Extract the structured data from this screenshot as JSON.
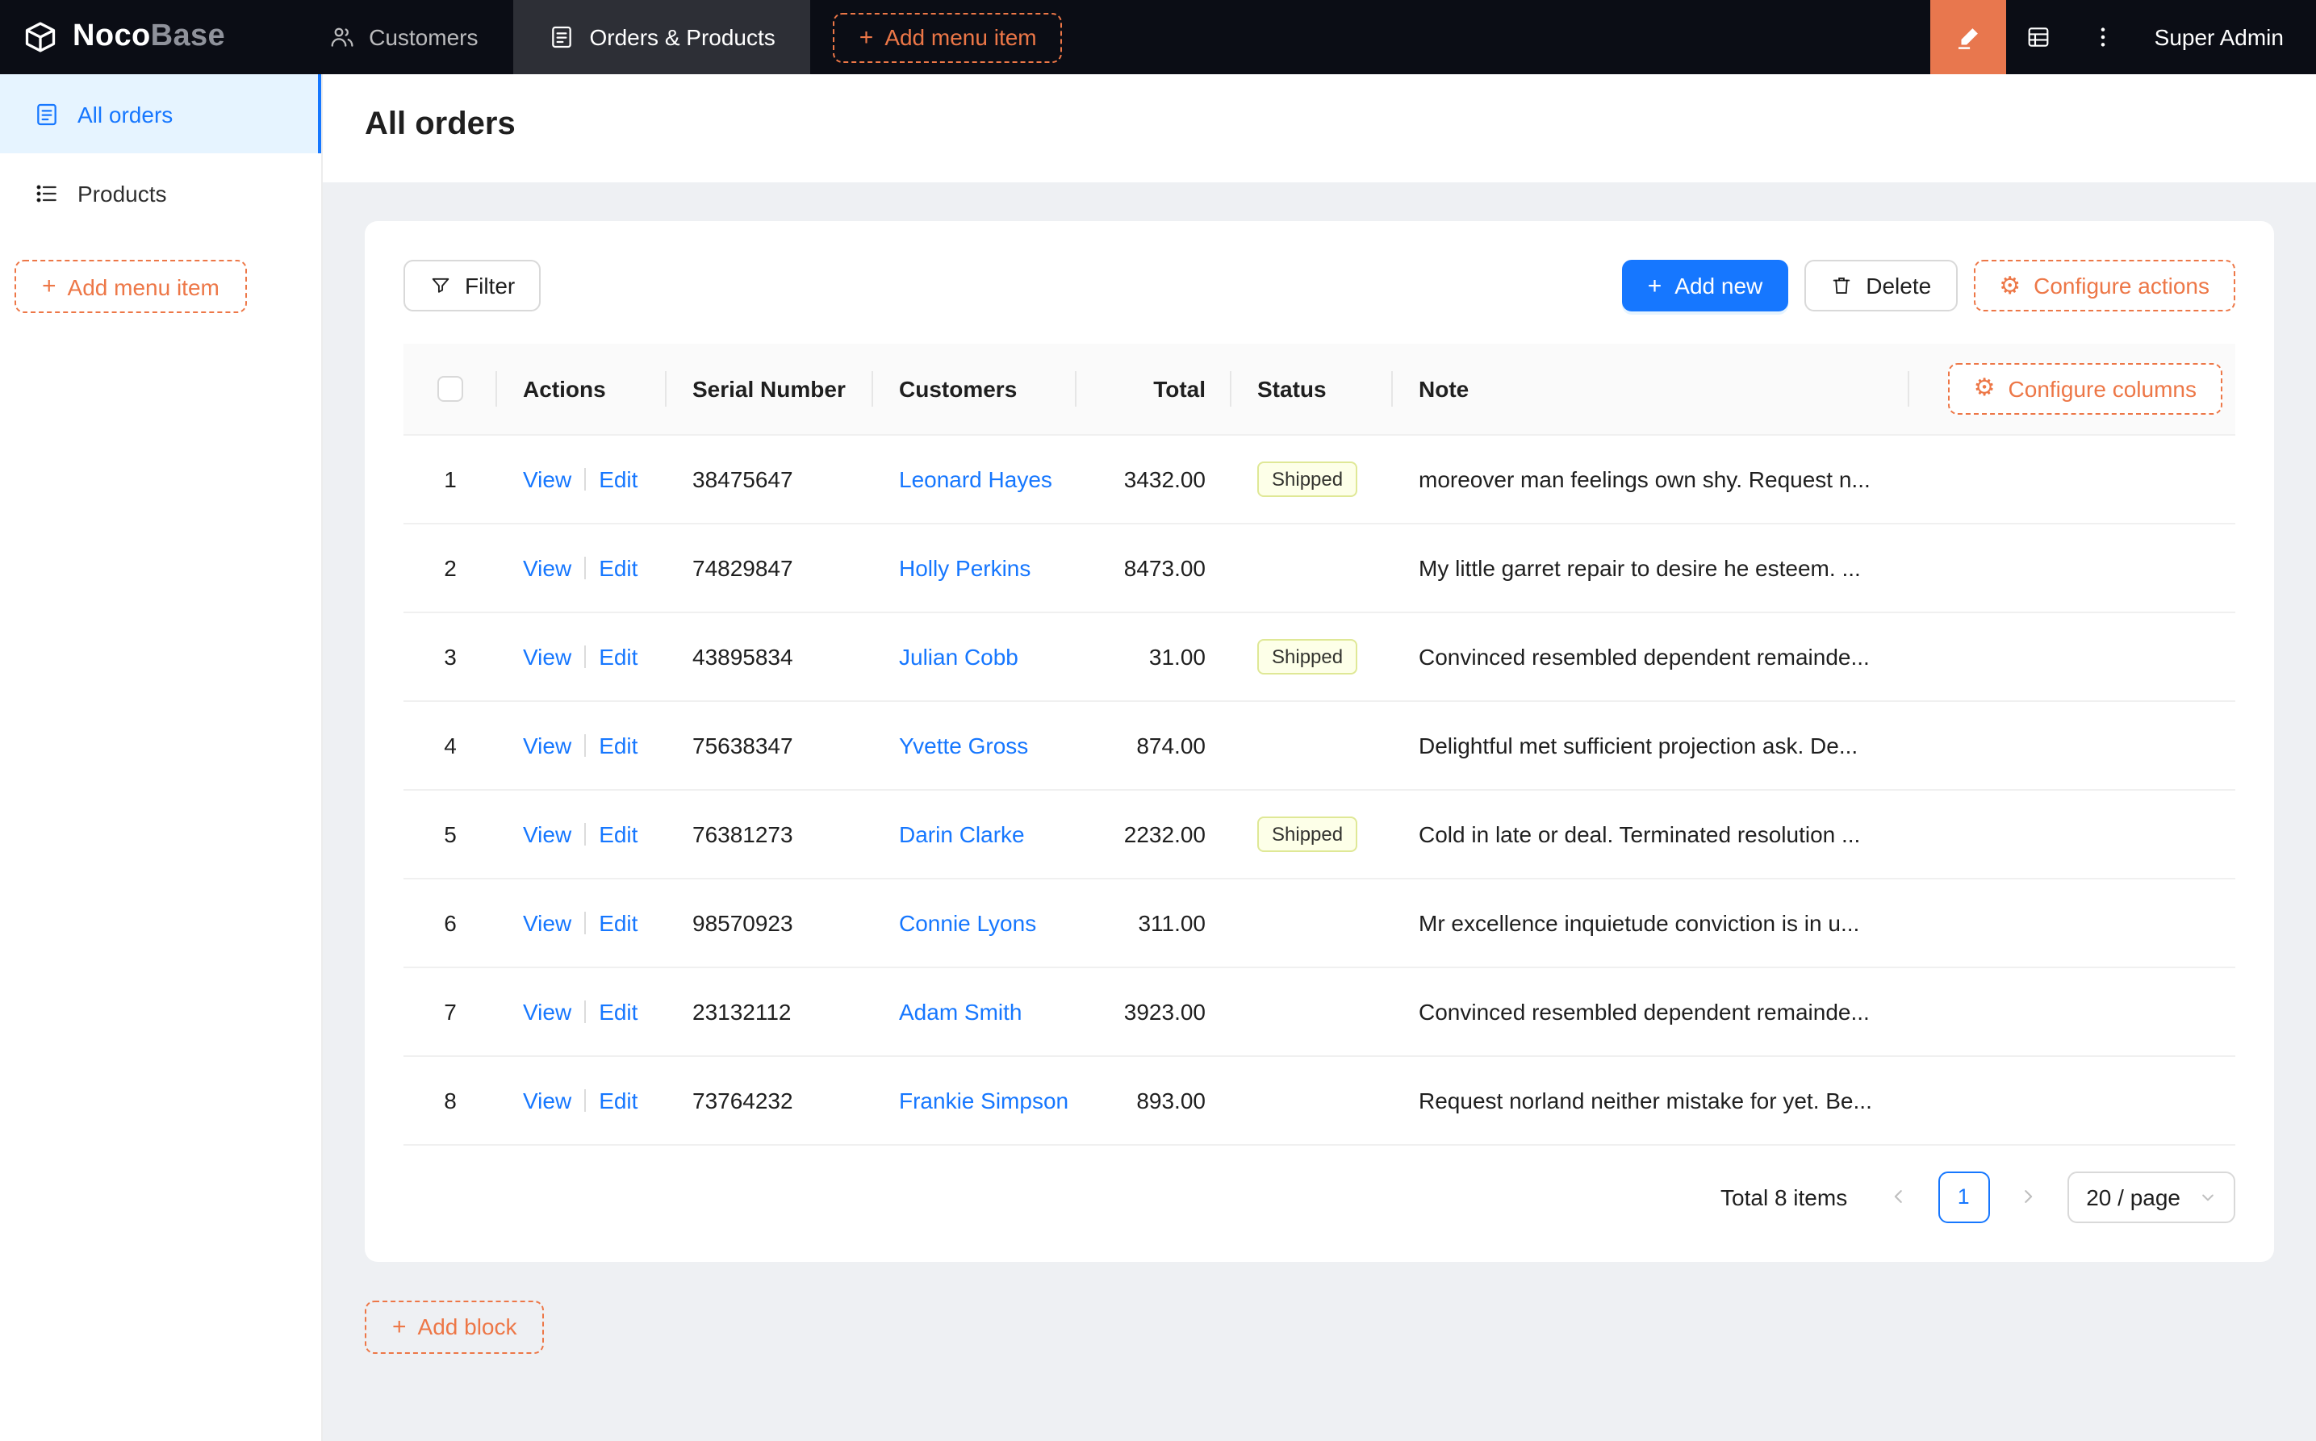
{
  "colors": {
    "header_bg": "#0b0d15",
    "accent_orange": "#ed7747",
    "designer_button_bg": "#e8774e",
    "primary_blue": "#1677ff",
    "active_menu_bg": "#e6f4ff",
    "tag_bg": "#fdffe8",
    "tag_border": "#dfe896",
    "content_bg": "#eef0f3"
  },
  "header": {
    "logo_bold": "Noco",
    "logo_light": "Base",
    "nav": [
      {
        "label": "Customers"
      },
      {
        "label": "Orders & Products"
      }
    ],
    "add_menu_item": "Add menu item",
    "user": "Super Admin"
  },
  "sidebar": {
    "items": [
      {
        "label": "All orders"
      },
      {
        "label": "Products"
      }
    ],
    "add_menu_item": "Add menu item"
  },
  "page": {
    "title": "All orders",
    "add_block": "Add block"
  },
  "toolbar": {
    "filter": "Filter",
    "add_new": "Add new",
    "delete": "Delete",
    "configure_actions": "Configure actions"
  },
  "table": {
    "configure_columns": "Configure columns",
    "columns": {
      "actions": "Actions",
      "serial": "Serial Number",
      "customers": "Customers",
      "total": "Total",
      "status": "Status",
      "note": "Note"
    },
    "row_actions": {
      "view": "View",
      "edit": "Edit"
    },
    "rows": [
      {
        "index": "1",
        "serial": "38475647",
        "customer": "Leonard Hayes",
        "total": "3432.00",
        "status": "Shipped",
        "note": "moreover man feelings own shy. Request n..."
      },
      {
        "index": "2",
        "serial": "74829847",
        "customer": "Holly Perkins",
        "total": "8473.00",
        "status": "",
        "note": "My little garret repair to desire he esteem. ..."
      },
      {
        "index": "3",
        "serial": "43895834",
        "customer": "Julian Cobb",
        "total": "31.00",
        "status": "Shipped",
        "note": "Convinced resembled dependent remainde..."
      },
      {
        "index": "4",
        "serial": "75638347",
        "customer": "Yvette Gross",
        "total": "874.00",
        "status": "",
        "note": "Delightful met sufficient projection ask. De..."
      },
      {
        "index": "5",
        "serial": "76381273",
        "customer": "Darin Clarke",
        "total": "2232.00",
        "status": "Shipped",
        "note": "Cold in late or deal. Terminated resolution ..."
      },
      {
        "index": "6",
        "serial": "98570923",
        "customer": "Connie Lyons",
        "total": "311.00",
        "status": "",
        "note": "Mr excellence inquietude conviction is in u..."
      },
      {
        "index": "7",
        "serial": "23132112",
        "customer": "Adam Smith",
        "total": "3923.00",
        "status": "",
        "note": "Convinced resembled dependent remainde..."
      },
      {
        "index": "8",
        "serial": "73764232",
        "customer": "Frankie Simpson",
        "total": "893.00",
        "status": "",
        "note": "Request norland neither mistake for yet. Be..."
      }
    ]
  },
  "pagination": {
    "total": "Total 8 items",
    "page": "1",
    "page_size": "20 / page"
  }
}
